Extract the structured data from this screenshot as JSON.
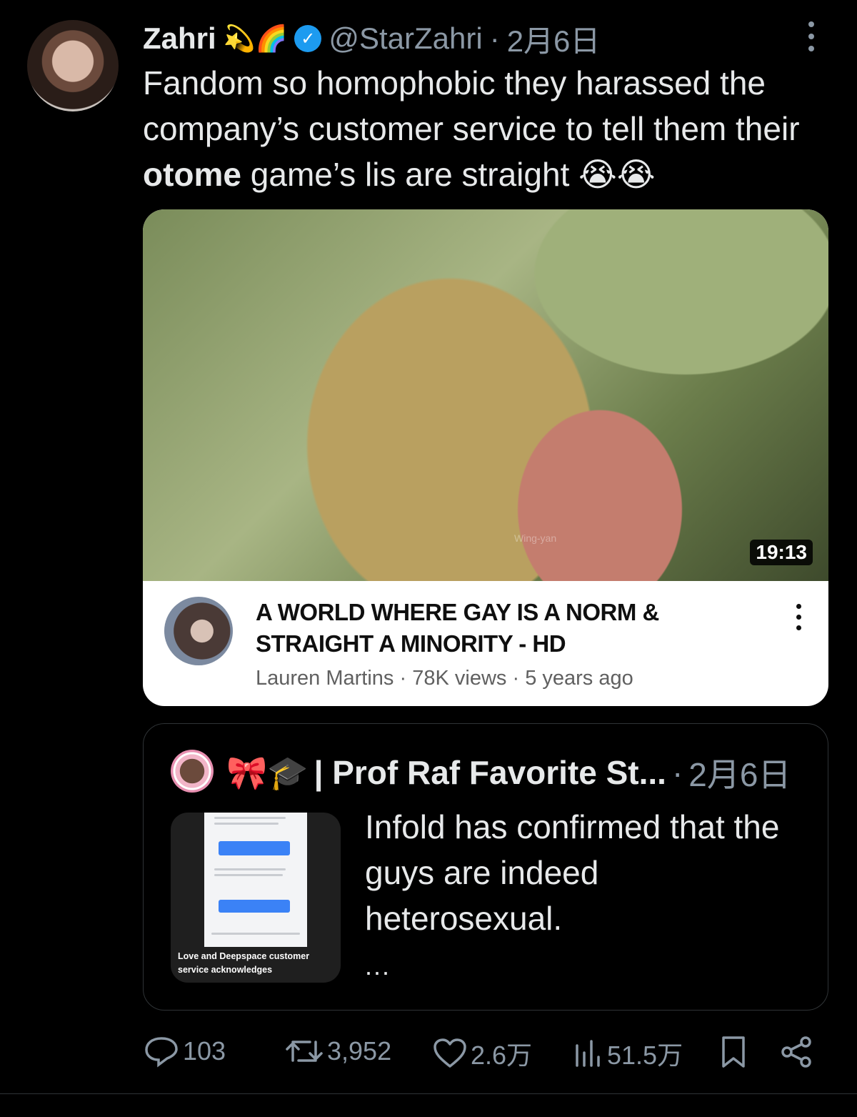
{
  "tweet": {
    "display_name": "Zahri",
    "name_emojis": "💫🌈",
    "handle": "@StarZahri",
    "separator": "·",
    "date": "2月6日",
    "text_before": "Fandom so homophobic they harassed the company’s customer service to tell them their ",
    "text_bold": "otome",
    "text_after": " game’s lis are straight ",
    "text_emojis": "😭😭"
  },
  "video": {
    "duration": "19:13",
    "watermark": "Wing-yan",
    "title_line1": "A WORLD WHERE GAY IS A NORM &",
    "title_line2": "STRAIGHT A MINORITY - HD",
    "channel": "Lauren Martins",
    "views": "78K views",
    "age": "5 years ago",
    "meta_separator": "·"
  },
  "quote": {
    "name_emojis": "🎀🎓",
    "name": "| Prof Raf Favorite St...",
    "separator": "·",
    "date": "2月6日",
    "text": "Infold has confirmed that the guys are indeed heterosexual.",
    "ellipsis": "...",
    "media_caption": "Love and Deepspace customer service acknowledges"
  },
  "actions": {
    "replies": "103",
    "reposts": "3,952",
    "likes": "2.6万",
    "views": "51.5万"
  },
  "colors": {
    "background": "#000000",
    "text": "#e7e9ea",
    "muted": "#8b98a5",
    "verified": "#1d9bf0",
    "border": "#2f3336"
  }
}
